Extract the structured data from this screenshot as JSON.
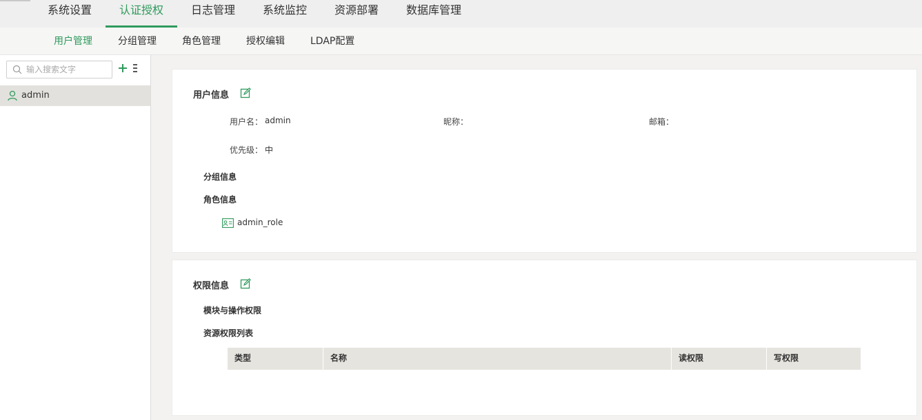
{
  "top_tabs": [
    {
      "label": "系统设置"
    },
    {
      "label": "认证授权"
    },
    {
      "label": "日志管理"
    },
    {
      "label": "系统监控"
    },
    {
      "label": "资源部署"
    },
    {
      "label": "数据库管理"
    }
  ],
  "active_top_tab": "认证授权",
  "sub_tabs": [
    {
      "label": "用户管理"
    },
    {
      "label": "分组管理"
    },
    {
      "label": "角色管理"
    },
    {
      "label": "授权编辑"
    },
    {
      "label": "LDAP配置"
    }
  ],
  "active_sub_tab": "用户管理",
  "sidebar": {
    "search_placeholder": "输入搜索文字",
    "users": [
      {
        "name": "admin"
      }
    ]
  },
  "user_info": {
    "title": "用户信息",
    "username_label": "用户名：",
    "username": "admin",
    "nickname_label": "昵称：",
    "nickname": "",
    "email_label": "邮箱：",
    "email": "",
    "priority_label": "优先级：",
    "priority": "中",
    "group_section": "分组信息",
    "role_section": "角色信息",
    "roles": [
      {
        "name": "admin_role"
      }
    ]
  },
  "permission_info": {
    "title": "权限信息",
    "module_section": "模块与操作权限",
    "resource_section": "资源权限列表",
    "columns": [
      "类型",
      "名称",
      "读权限",
      "写权限"
    ]
  },
  "colors": {
    "accent": "#2e9a5b",
    "selected_row": "#e2e1dd",
    "table_header": "#e6e4df"
  }
}
